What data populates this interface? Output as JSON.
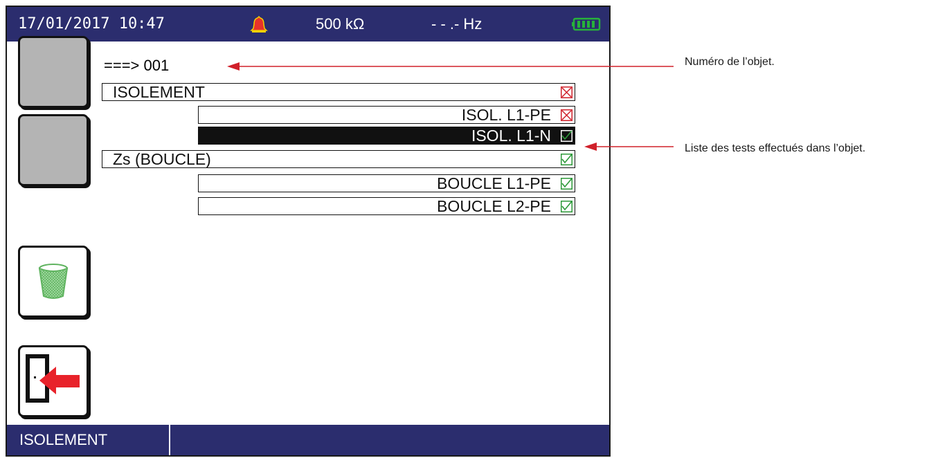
{
  "status_bar": {
    "datetime": "17/01/2017 10:47",
    "voltage": "500  kΩ",
    "frequency": "- - .-  Hz",
    "alarm_icon": "alarm-bell-icon",
    "battery_icon": "battery-full-icon"
  },
  "sidebar": {
    "buttons": [
      {
        "name": "blank-button-1"
      },
      {
        "name": "blank-button-2"
      },
      {
        "name": "delete-button",
        "icon": "trash-icon"
      },
      {
        "name": "exit-button",
        "icon": "exit-door-icon"
      }
    ]
  },
  "main": {
    "object_number": "===> 001",
    "tests": [
      {
        "label": "ISOLEMENT",
        "level": 0,
        "status": "fail",
        "selected": false
      },
      {
        "label": "ISOL. L1-PE",
        "level": 1,
        "status": "fail",
        "selected": false
      },
      {
        "label": "ISOL. L1-N",
        "level": 1,
        "status": "pass",
        "selected": true
      },
      {
        "label": "Zs (BOUCLE)",
        "level": 0,
        "status": "pass",
        "selected": false
      },
      {
        "label": "BOUCLE L1-PE",
        "level": 1,
        "status": "pass",
        "selected": false
      },
      {
        "label": "BOUCLE L2-PE",
        "level": 1,
        "status": "pass",
        "selected": false
      }
    ]
  },
  "bottom_bar": {
    "tab_label": "ISOLEMENT"
  },
  "annotations": {
    "object_number": "Numéro de l’objet.",
    "tests_list": "Liste des tests effectués dans l’objet."
  },
  "colors": {
    "bar": "#2b2d6e",
    "fail": "#d0202a",
    "pass": "#2e9a3a",
    "arrow": "#d0202a",
    "battery": "#27b33a",
    "alarm": "#e8322a"
  }
}
